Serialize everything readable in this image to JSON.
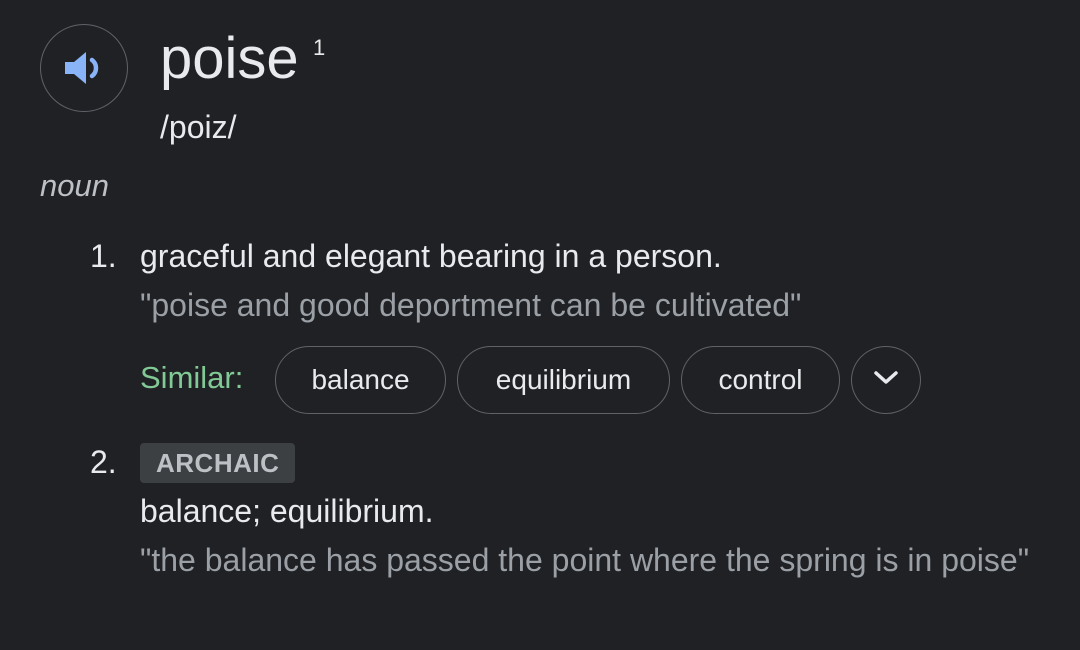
{
  "entry": {
    "word": "poise",
    "superscript": "1",
    "phonetic": "/poiz/",
    "part_of_speech": "noun",
    "audio_icon": "speaker-icon"
  },
  "senses": [
    {
      "number": "1.",
      "definition": "graceful and elegant bearing in a person.",
      "example": "\"poise and good deportment can be cultivated\"",
      "similar_label": "Similar:",
      "similar": [
        "balance",
        "equilibrium",
        "control"
      ],
      "expand_icon": "chevron-down-icon"
    },
    {
      "number": "2.",
      "tag": "ARCHAIC",
      "definition": "balance; equilibrium.",
      "example": "\"the balance has passed the point where the spring is in poise\""
    }
  ],
  "colors": {
    "background": "#202124",
    "text": "#e8eaed",
    "muted": "#9aa0a6",
    "similar_label": "#81c995",
    "speaker_icon": "#8ab4f8",
    "chip_border": "#5f6368",
    "tag_bg": "#3c4043"
  }
}
